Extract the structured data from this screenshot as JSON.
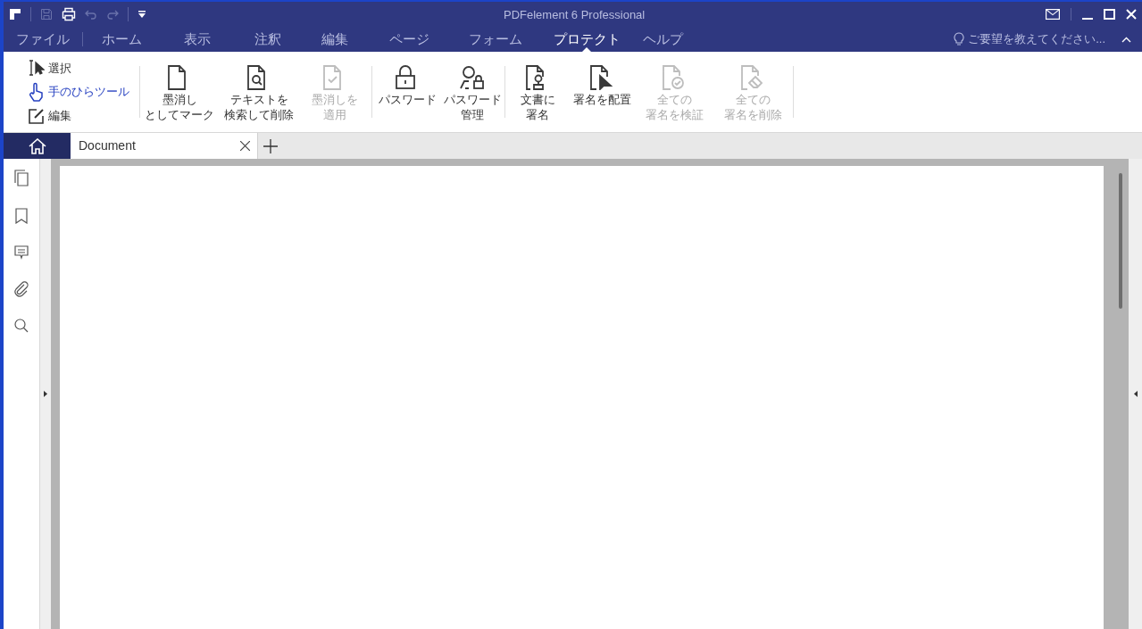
{
  "window": {
    "title": "PDFelement 6 Professional"
  },
  "menu_tabs": [
    {
      "label": "ファイル",
      "selected": false
    },
    {
      "label": "ホーム",
      "selected": false
    },
    {
      "label": "表示",
      "selected": false
    },
    {
      "label": "注釈",
      "selected": false
    },
    {
      "label": "編集",
      "selected": false
    },
    {
      "label": "ページ",
      "selected": false
    },
    {
      "label": "フォーム",
      "selected": false
    },
    {
      "label": "プロテクト",
      "selected": true
    },
    {
      "label": "ヘルプ",
      "selected": false
    }
  ],
  "feedback_prompt": "ご要望を教えてください...",
  "ribbon": {
    "tools": [
      {
        "label": "選択",
        "kind": "select",
        "selected": false
      },
      {
        "label": "手のひらツール",
        "kind": "hand",
        "selected": true
      },
      {
        "label": "編集",
        "kind": "edit",
        "selected": false
      }
    ],
    "groups": [
      [
        {
          "lines": [
            "墨消し",
            "としてマーク"
          ],
          "kind": "doc",
          "disabled": false
        },
        {
          "lines": [
            "テキストを",
            "検索して削除"
          ],
          "kind": "doc-search",
          "disabled": false
        },
        {
          "lines": [
            "墨消しを",
            "適用"
          ],
          "kind": "doc-check",
          "disabled": true
        }
      ],
      [
        {
          "lines": [
            "パスワード"
          ],
          "kind": "lock",
          "disabled": false
        },
        {
          "lines": [
            "パスワード",
            "管理"
          ],
          "kind": "user-lock",
          "disabled": false
        }
      ],
      [
        {
          "lines": [
            "文書に",
            "署名"
          ],
          "kind": "doc-user",
          "disabled": false
        },
        {
          "lines": [
            "署名を配置"
          ],
          "kind": "doc-cursor",
          "disabled": false
        },
        {
          "lines": [
            "全ての",
            "署名を検証"
          ],
          "kind": "doc-verify",
          "disabled": true
        },
        {
          "lines": [
            "全ての",
            "署名を削除"
          ],
          "kind": "doc-eraser",
          "disabled": true
        }
      ]
    ]
  },
  "doc_tabs": [
    {
      "label": "Document",
      "selected": true
    }
  ]
}
